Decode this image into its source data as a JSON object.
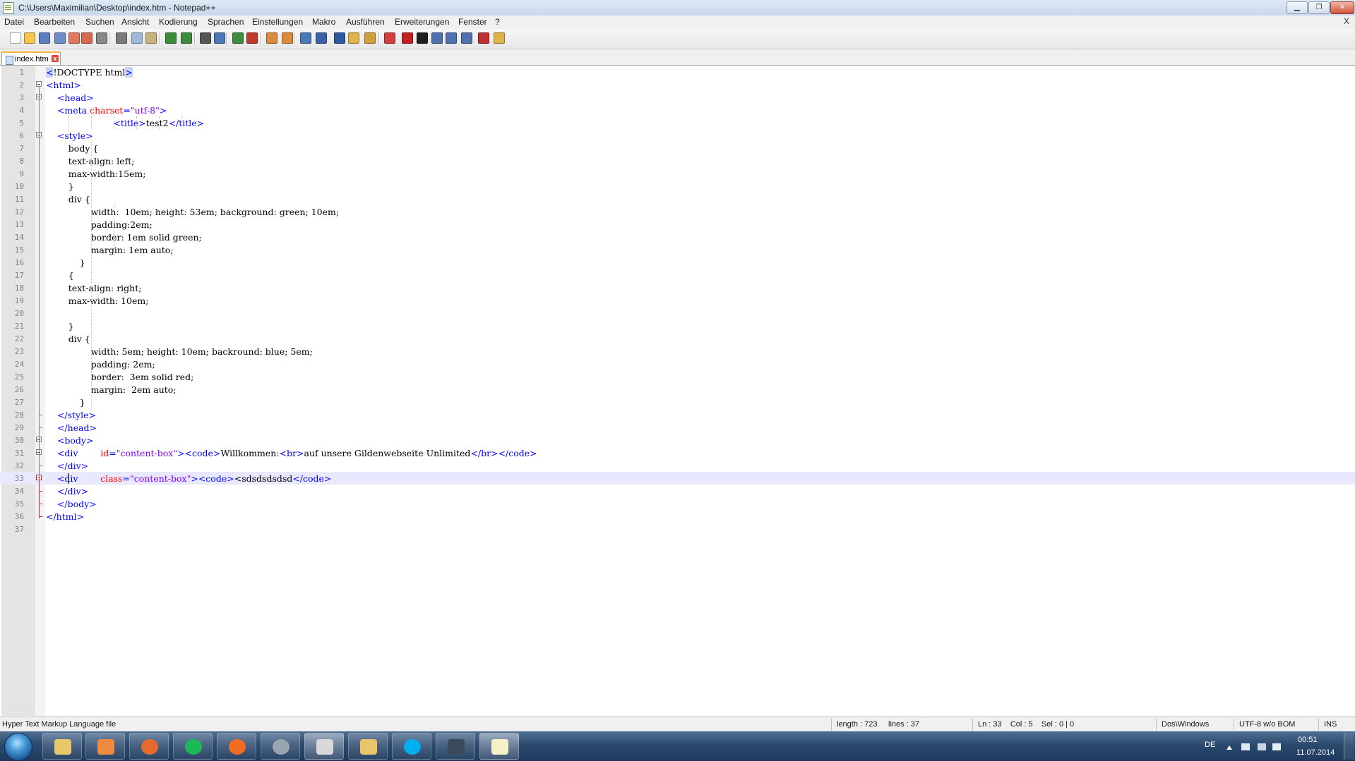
{
  "window": {
    "title": "C:\\Users\\Maximilian\\Desktop\\index.htm - Notepad++",
    "minimize": "▁",
    "maximize": "❐",
    "close": "✕"
  },
  "menu": [
    "Datei",
    "Bearbeiten",
    "Suchen",
    "Ansicht",
    "Kodierung",
    "Sprachen",
    "Einstellungen",
    "Makro",
    "Ausführen",
    "Erweiterungen",
    "Fenster",
    "?"
  ],
  "menu_close": "X",
  "toolbar_icons": [
    "new-file-icon",
    "open-file-icon",
    "save-icon",
    "save-all-icon",
    "close-icon",
    "close-all-icon",
    "print-icon",
    "cut-icon",
    "copy-icon",
    "paste-icon",
    "undo-icon",
    "redo-icon",
    "find-icon",
    "replace-icon",
    "zoom-in-icon",
    "zoom-out-icon",
    "sync-vertical-icon",
    "sync-horizontal-icon",
    "word-wrap-icon",
    "show-all-chars-icon",
    "indent-guide-icon",
    "user-lang-icon",
    "doc-map-icon",
    "function-list-icon",
    "record-macro-icon",
    "stop-record-icon",
    "play-macro-icon",
    "run-macro-multiple-icon",
    "save-macro-icon",
    "spell-check-icon",
    "plugin-icon"
  ],
  "tab": {
    "label": "index.htm",
    "close": "x"
  },
  "editor": {
    "current_line": 33,
    "lines": [
      [
        {
          "t": "<",
          "c": "t-hl"
        },
        {
          "t": "!DOCTYPE html",
          "c": "t-dt"
        },
        {
          "t": ">",
          "c": "t-hl"
        }
      ],
      [
        {
          "t": "<html>",
          "c": "t-tag"
        }
      ],
      [
        {
          "t": "    <head>",
          "c": "t-tag"
        }
      ],
      [
        {
          "t": "    <meta ",
          "c": "t-tag"
        },
        {
          "t": "charset",
          "c": "t-attr"
        },
        {
          "t": "=",
          "c": "t-tag"
        },
        {
          "t": "\"utf-8\"",
          "c": "t-str"
        },
        {
          "t": ">",
          "c": "t-tag"
        }
      ],
      [
        {
          "t": "                        <title>",
          "c": "t-tag"
        },
        {
          "t": "test2",
          "c": "t-dt"
        },
        {
          "t": "</title>",
          "c": "t-tag"
        }
      ],
      [
        {
          "t": "    <style>",
          "c": "t-tag"
        }
      ],
      [
        {
          "t": "        body {",
          "c": "t-dt"
        }
      ],
      [
        {
          "t": "        text-align: left;",
          "c": "t-dt"
        }
      ],
      [
        {
          "t": "        max-width:15em;",
          "c": "t-dt"
        }
      ],
      [
        {
          "t": "        }",
          "c": "t-dt"
        }
      ],
      [
        {
          "t": "        div {",
          "c": "t-dt"
        }
      ],
      [
        {
          "t": "                width:  10em; height: 53em; background: green; 10em;",
          "c": "t-dt"
        }
      ],
      [
        {
          "t": "                padding:2em;",
          "c": "t-dt"
        }
      ],
      [
        {
          "t": "                border: 1em solid green;",
          "c": "t-dt"
        }
      ],
      [
        {
          "t": "                margin: 1em auto;",
          "c": "t-dt"
        }
      ],
      [
        {
          "t": "            }",
          "c": "t-dt"
        }
      ],
      [
        {
          "t": "        {",
          "c": "t-dt"
        }
      ],
      [
        {
          "t": "        text-align: right;",
          "c": "t-dt"
        }
      ],
      [
        {
          "t": "        max-width: 10em;",
          "c": "t-dt"
        }
      ],
      [
        {
          "t": "",
          "c": "t-dt"
        }
      ],
      [
        {
          "t": "        }",
          "c": "t-dt"
        }
      ],
      [
        {
          "t": "        div {",
          "c": "t-dt"
        }
      ],
      [
        {
          "t": "                width: 5em; height: 10em; backround: blue; 5em;",
          "c": "t-dt"
        }
      ],
      [
        {
          "t": "                padding: 2em;",
          "c": "t-dt"
        }
      ],
      [
        {
          "t": "                border:  3em solid red;",
          "c": "t-dt"
        }
      ],
      [
        {
          "t": "                margin:  2em auto;",
          "c": "t-dt"
        }
      ],
      [
        {
          "t": "            }",
          "c": "t-dt"
        }
      ],
      [
        {
          "t": "    </style>",
          "c": "t-tag"
        }
      ],
      [
        {
          "t": "    </head>",
          "c": "t-tag"
        }
      ],
      [
        {
          "t": "    <body>",
          "c": "t-tag"
        }
      ],
      [
        {
          "t": "    <div        ",
          "c": "t-tag"
        },
        {
          "t": "id",
          "c": "t-attr"
        },
        {
          "t": "=",
          "c": "t-tag"
        },
        {
          "t": "\"content-box\"",
          "c": "t-str"
        },
        {
          "t": "><code>",
          "c": "t-tag"
        },
        {
          "t": "Willkommen:",
          "c": "t-dt"
        },
        {
          "t": "<br>",
          "c": "t-tag"
        },
        {
          "t": "auf unsere Gildenwebseite Unlimited",
          "c": "t-dt"
        },
        {
          "t": "</br></code>",
          "c": "t-tag"
        }
      ],
      [
        {
          "t": "    </div>",
          "c": "t-tag"
        }
      ],
      [
        {
          "t": "    <div        ",
          "c": "t-tag"
        },
        {
          "t": "class",
          "c": "t-attr"
        },
        {
          "t": "=",
          "c": "t-tag"
        },
        {
          "t": "\"content-box\"",
          "c": "t-str"
        },
        {
          "t": "><code>",
          "c": "t-tag"
        },
        {
          "t": "<sdsdsdsdsd",
          "c": "t-dt"
        },
        {
          "t": "</code>",
          "c": "t-tag"
        }
      ],
      [
        {
          "t": "    </div>",
          "c": "t-tag"
        }
      ],
      [
        {
          "t": "    </body>",
          "c": "t-tag"
        }
      ],
      [
        {
          "t": "</html>",
          "c": "t-tag"
        }
      ],
      [
        {
          "t": "",
          "c": "t-dt"
        }
      ]
    ]
  },
  "status": {
    "filetype": "Hyper Text Markup Language file",
    "length": "length : 723",
    "lines": "lines : 37",
    "position": "Ln : 33    Col : 5    Sel : 0 | 0",
    "eol": "Dos\\Windows",
    "encoding": "UTF-8 w/o BOM",
    "mode": "INS"
  },
  "taskbar": {
    "apps": [
      "explorer-icon",
      "media-player-icon",
      "firefox-icon",
      "spotify-icon",
      "origin-icon",
      "audio-icon",
      "snipping-tool-icon",
      "mail-icon",
      "skype-icon",
      "teamspeak-icon",
      "notepad-plus-plus-icon"
    ],
    "language": "DE",
    "time": "00:51",
    "date": "11.07.2014"
  },
  "colors": {
    "tag": "#0000ff",
    "attribute": "#ff0000",
    "string": "#8000ff",
    "current_line": "#e8e8ff",
    "tab_accent": "#fab03c"
  }
}
